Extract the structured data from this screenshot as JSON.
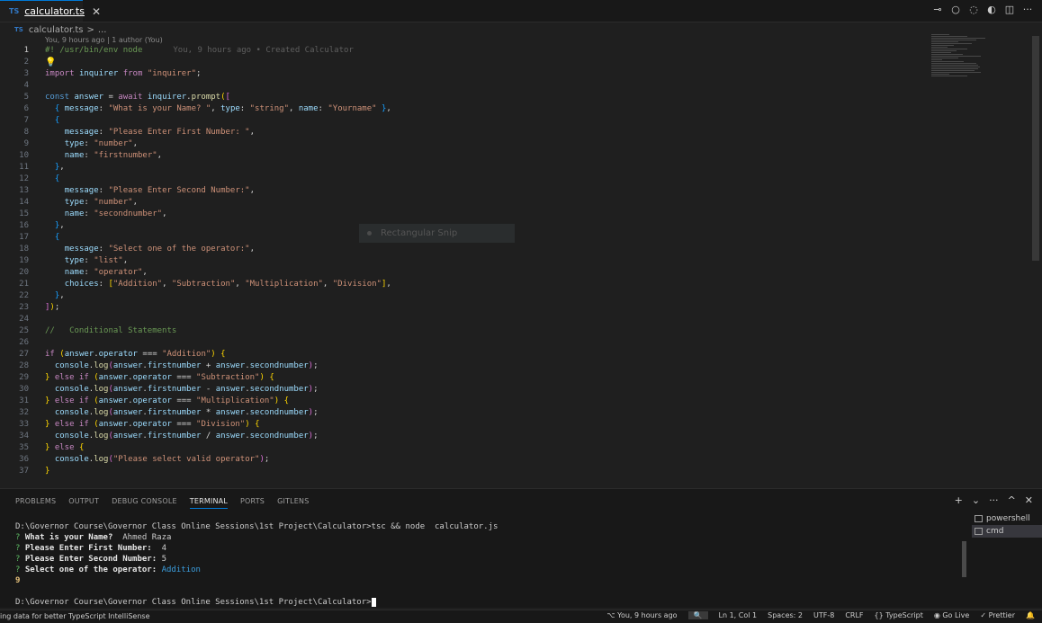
{
  "tab": {
    "badge": "TS",
    "label": "calculator.ts",
    "close": "✕"
  },
  "breadcrumb": {
    "badge": "TS",
    "file": "calculator.ts",
    "sep": ">",
    "more": "..."
  },
  "blame": {
    "header": "You, 9 hours ago | 1 author (You)",
    "inline": "You, 9 hours ago • Created Calculator"
  },
  "editor": {
    "lines": [
      "1",
      "2",
      "3",
      "4",
      "5",
      "6",
      "7",
      "8",
      "9",
      "10",
      "11",
      "12",
      "13",
      "14",
      "15",
      "16",
      "17",
      "18",
      "19",
      "20",
      "21",
      "22",
      "23",
      "24",
      "25",
      "26",
      "27",
      "28",
      "29",
      "30",
      "31",
      "32",
      "33",
      "34",
      "35",
      "36",
      "37"
    ],
    "code": {
      "l1": "#! /usr/bin/env node",
      "import": "import",
      "inquirer": "inquirer",
      "from": "from",
      "mod": "\"inquirer\"",
      "const": "const",
      "answer": "answer",
      "await": "await",
      "prompt": "prompt",
      "msg6": "\"What is your Name? \"",
      "type_str": "\"string\"",
      "name6": "\"Yourname\"",
      "msg8": "\"Please Enter First Number: \"",
      "type_num": "\"number\"",
      "name10": "\"firstnumber\"",
      "msg13": "\"Please Enter Second Number:\"",
      "name15": "\"secondnumber\"",
      "msg18": "\"Select one of the operator:\"",
      "type_list": "\"list\"",
      "name20": "\"operator\"",
      "choices": [
        "\"Addition\"",
        "\"Subtraction\"",
        "\"Multiplication\"",
        "\"Division\""
      ],
      "comment": "//   Conditional Statements",
      "op_add": "\"Addition\"",
      "op_sub": "\"Subtraction\"",
      "op_mul": "\"Multiplication\"",
      "op_div": "\"Division\"",
      "invalid": "\"Please select valid operator\""
    }
  },
  "snip": {
    "label": "Rectangular Snip"
  },
  "panel": {
    "tabs": [
      "PROBLEMS",
      "OUTPUT",
      "DEBUG CONSOLE",
      "TERMINAL",
      "PORTS",
      "GITLENS"
    ],
    "actions": [
      "+",
      "⌄",
      "···",
      "^",
      "✕"
    ],
    "terminal": {
      "cmd": "D:\\Governor Course\\Governor Class Online Sessions\\1st Project\\Calculator>tsc && node  calculator.js",
      "q1": "What is your Name?",
      "a1": "Ahmed Raza",
      "q2": "Please Enter First Number:",
      "a2": "4",
      "q3": "Please Enter Second Number:",
      "a3": "5",
      "q4": "Select one of the operator:",
      "a4": "Addition",
      "result": "9",
      "prompt": "D:\\Governor Course\\Governor Class Online Sessions\\1st Project\\Calculator>"
    },
    "shells": [
      "powershell",
      "cmd"
    ]
  },
  "status": {
    "left": "ing data for better TypeScript IntelliSense",
    "blame": "You, 9 hours ago",
    "position": "Ln 1, Col 1",
    "spaces": "Spaces: 2",
    "encoding": "UTF-8",
    "eol": "CRLF",
    "language": "TypeScript",
    "golive": "Go Live",
    "prettier": "Prettier"
  }
}
